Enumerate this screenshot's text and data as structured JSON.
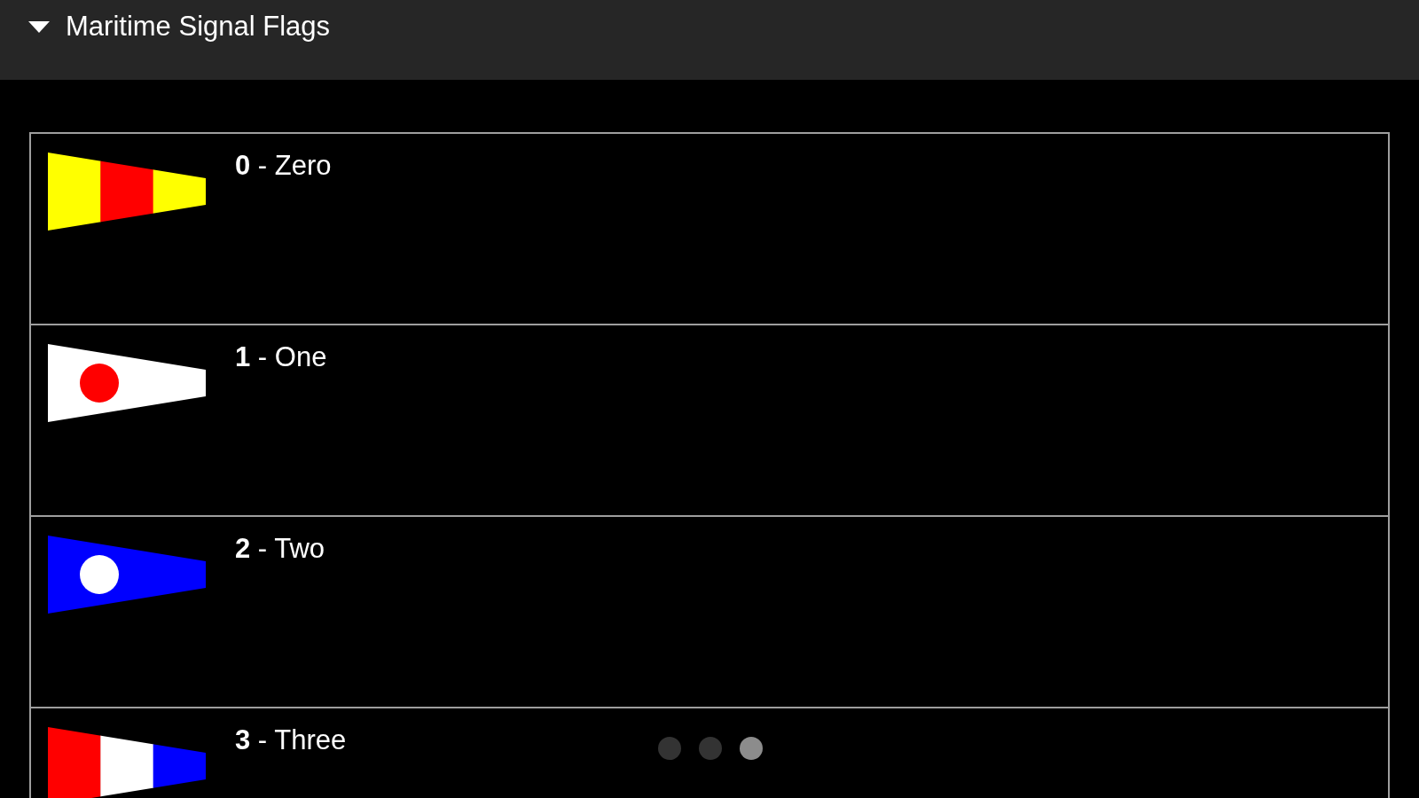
{
  "header": {
    "title": "Maritime Signal Flags",
    "expanded": true
  },
  "flags": [
    {
      "label": "**0** - Zero",
      "kind": "stripes",
      "parts": [
        {
          "color": "#ffff00"
        },
        {
          "color": "#ff0000"
        },
        {
          "color": "#ffff00"
        }
      ]
    },
    {
      "label": "**1** - One",
      "kind": "disc",
      "parts": [
        {
          "color": "#ffffff"
        },
        {
          "color": "#ff0000"
        }
      ]
    },
    {
      "label": "**2** - Two",
      "kind": "disc",
      "parts": [
        {
          "color": "#0000ff"
        },
        {
          "color": "#ffffff"
        }
      ]
    },
    {
      "label": "**3** - Three",
      "kind": "stripes",
      "parts": [
        {
          "color": "#ff0000"
        },
        {
          "color": "#ffffff"
        },
        {
          "color": "#0000ff"
        }
      ]
    }
  ],
  "pager": [
    {
      "selected": false
    },
    {
      "selected": false
    },
    {
      "selected": true
    }
  ]
}
